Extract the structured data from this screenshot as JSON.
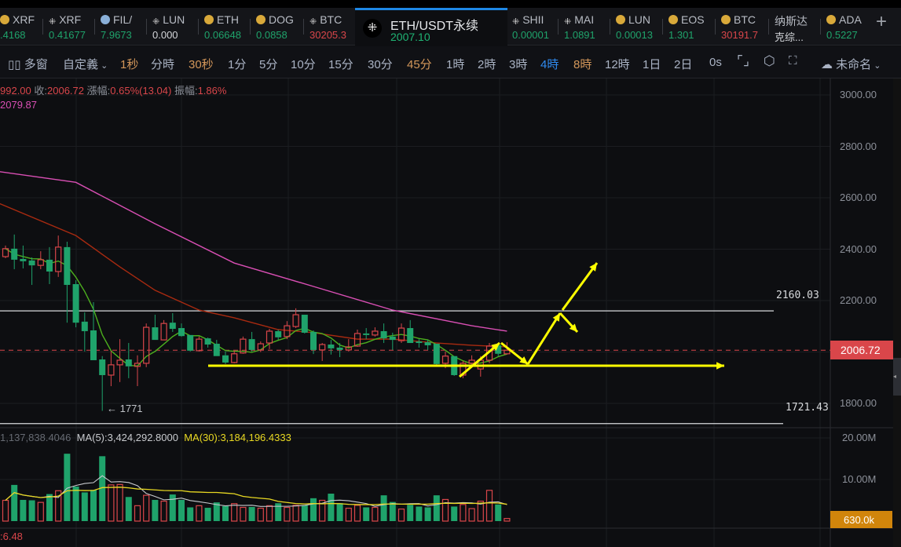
{
  "tickers": [
    {
      "name": "XRF",
      "price": ".4168",
      "color": "green",
      "icon": "coin-icon"
    },
    {
      "name": "XRF",
      "price": "0.41677",
      "color": "green",
      "icon": "okx-icon"
    },
    {
      "name": "FIL/",
      "price": "7.9673",
      "color": "green",
      "icon": "filecoin-icon"
    },
    {
      "name": "LUN",
      "price": "0.000",
      "color": "white",
      "icon": "okx-icon"
    },
    {
      "name": "ETH",
      "price": "0.06648",
      "color": "green",
      "icon": "coin-icon"
    },
    {
      "name": "DOG",
      "price": "0.0858",
      "color": "green",
      "icon": "coin-icon"
    },
    {
      "name": "BTC",
      "price": "30205.3",
      "color": "red",
      "icon": "okx-icon"
    }
  ],
  "active_ticker": {
    "name": "ETH/USDT永续",
    "price": "2007.10",
    "icon": "okx-icon"
  },
  "tickers_right": [
    {
      "name": "SHII",
      "price": "0.00001",
      "color": "green",
      "icon": "okx-icon"
    },
    {
      "name": "MAI",
      "price": "1.0891",
      "color": "green",
      "icon": "okx-icon"
    },
    {
      "name": "LUN",
      "price": "0.00013",
      "color": "green",
      "icon": "coin-icon"
    },
    {
      "name": "EOS",
      "price": "1.301",
      "color": "green",
      "icon": "coin-icon"
    },
    {
      "name": "BTC",
      "price": "30191.7",
      "color": "red",
      "icon": "coin-icon"
    },
    {
      "name": "纳斯达",
      "price": "克综...",
      "color": "white",
      "icon": ""
    },
    {
      "name": "ADA",
      "price": "0.5227",
      "color": "green",
      "icon": "coin-icon"
    }
  ],
  "toolbar": {
    "multiwindow": "多窗",
    "custom": "自定義",
    "intervals": [
      {
        "label": "1秒",
        "style": "or"
      },
      {
        "label": "分時",
        "style": ""
      },
      {
        "label": "30秒",
        "style": "or"
      },
      {
        "label": "1分",
        "style": ""
      },
      {
        "label": "5分",
        "style": ""
      },
      {
        "label": "10分",
        "style": ""
      },
      {
        "label": "15分",
        "style": ""
      },
      {
        "label": "30分",
        "style": ""
      },
      {
        "label": "45分",
        "style": "or"
      },
      {
        "label": "1時",
        "style": ""
      },
      {
        "label": "2時",
        "style": ""
      },
      {
        "label": "3時",
        "style": ""
      },
      {
        "label": "4時",
        "style": "bl"
      },
      {
        "label": "8時",
        "style": "or"
      },
      {
        "label": "12時",
        "style": ""
      },
      {
        "label": "1日",
        "style": ""
      },
      {
        "label": "2日",
        "style": ""
      },
      {
        "label": "0s",
        "style": ""
      }
    ],
    "layout_name": "未命名"
  },
  "info": {
    "open_partial": "992.00",
    "close_label": "收:",
    "close": "2006.72",
    "change_label": "漲幅:",
    "change": "0.65%(13.04)",
    "amp_label": "振幅:",
    "amp": "1.86%",
    "ma_value": "2079.87"
  },
  "volume_legend": {
    "vol": "1,137,838.4046",
    "ma5": "MA(5):3,424,292.8000",
    "ma30": "MA(30):3,184,196.4333",
    "bottom": ":6.48"
  },
  "colors": {
    "up": "#d9464a",
    "down": "#1fa36b",
    "ma_pink": "#d94fb4",
    "ma_brown": "#a82a10",
    "ma_green": "#4caf1e",
    "drawing": "#ffff00"
  },
  "chart_data": {
    "type": "candlestick",
    "price_axis": {
      "ticks": [
        "3000.00",
        "2800.00",
        "2600.00",
        "2400.00",
        "2200.00",
        "1800.00"
      ],
      "range": [
        1700,
        3000
      ],
      "current": "2006.72"
    },
    "volume_axis": {
      "ticks": [
        "20.00M",
        "10.00M"
      ],
      "current": "630.0k"
    },
    "horizontal_lines": [
      {
        "label": "2160.03",
        "value": 2160.03
      },
      {
        "label": "1721.43",
        "value": 1721.43
      }
    ],
    "low_marker": "← 1771",
    "candles": [
      [
        2371,
        2414,
        2365,
        2402
      ],
      [
        2402,
        2457,
        2322,
        2359
      ],
      [
        2362,
        2414,
        2325,
        2353
      ],
      [
        2356,
        2368,
        2261,
        2337
      ],
      [
        2337,
        2392,
        2322,
        2359
      ],
      [
        2359,
        2408,
        2264,
        2313
      ],
      [
        2313,
        2453,
        2292,
        2408
      ],
      [
        2408,
        2429,
        2114,
        2261
      ],
      [
        2264,
        2279,
        2096,
        2114
      ],
      [
        2118,
        2154,
        2002,
        2081
      ],
      [
        2084,
        2194,
        1968,
        1968
      ],
      [
        1971,
        1984,
        1771,
        1910
      ],
      [
        1910,
        2004,
        1867,
        1950
      ],
      [
        1950,
        2050,
        1883,
        1968
      ],
      [
        1971,
        2035,
        1898,
        1944
      ],
      [
        1944,
        1987,
        1867,
        1956
      ],
      [
        1956,
        2111,
        1941,
        2096
      ],
      [
        2096,
        2145,
        2047,
        2047
      ],
      [
        2047,
        2124,
        2047,
        2111
      ],
      [
        2114,
        2151,
        2078,
        2090
      ],
      [
        2093,
        2111,
        2059,
        2062
      ],
      [
        2066,
        2066,
        2002,
        2005
      ],
      [
        2005,
        2060,
        2002,
        2050
      ],
      [
        2053,
        2056,
        2017,
        2029
      ],
      [
        2032,
        2047,
        1984,
        1984
      ],
      [
        1987,
        2002,
        1953,
        1959
      ],
      [
        1959,
        2005,
        1956,
        1993
      ],
      [
        1996,
        2060,
        1993,
        2050
      ],
      [
        2050,
        2078,
        2002,
        2008
      ],
      [
        2008,
        2041,
        2000,
        2032
      ],
      [
        2035,
        2090,
        2011,
        2081
      ],
      [
        2081,
        2087,
        2047,
        2057
      ],
      [
        2060,
        2120,
        2050,
        2102
      ],
      [
        2099,
        2170,
        2093,
        2145
      ],
      [
        2145,
        2145,
        2072,
        2075
      ],
      [
        2078,
        2084,
        1992,
        2008
      ],
      [
        2008,
        2035,
        1965,
        2029
      ],
      [
        2029,
        2047,
        1990,
        2014
      ],
      [
        2017,
        2035,
        1980,
        2008
      ],
      [
        2008,
        2050,
        2002,
        2020
      ],
      [
        2023,
        2087,
        2020,
        2072
      ],
      [
        2072,
        2093,
        2050,
        2066
      ],
      [
        2066,
        2096,
        2060,
        2081
      ],
      [
        2081,
        2111,
        2035,
        2053
      ],
      [
        2060,
        2075,
        2008,
        2047
      ],
      [
        2044,
        2111,
        2035,
        2093
      ],
      [
        2093,
        2124,
        2035,
        2035
      ],
      [
        2041,
        2050,
        2017,
        2035
      ],
      [
        2038,
        2047,
        2008,
        2026
      ],
      [
        2032,
        2032,
        1950,
        1953
      ],
      [
        1956,
        2002,
        1937,
        1984
      ],
      [
        1984,
        1984,
        1907,
        1910
      ],
      [
        1910,
        1965,
        1898,
        1956
      ],
      [
        1956,
        1987,
        1944,
        1968
      ],
      [
        1934,
        1984,
        1904,
        1968
      ],
      [
        1968,
        2035,
        1956,
        2023
      ],
      [
        2026,
        2035,
        1984,
        1993
      ],
      [
        1993,
        2038,
        1990,
        2006.72
      ]
    ],
    "volumes_M": [
      5.0,
      8.7,
      5.1,
      5.0,
      4.5,
      6.5,
      7.3,
      16.2,
      8.3,
      6.9,
      7.5,
      15.6,
      8.7,
      8.8,
      5.8,
      3.7,
      6.2,
      5.1,
      4.8,
      6.4,
      5.1,
      3.3,
      3.7,
      3.2,
      4.5,
      3.6,
      4.2,
      3.3,
      3.4,
      3.1,
      3.7,
      4.3,
      3.3,
      3.8,
      3.8,
      5.5,
      5.0,
      6.6,
      4.3,
      3.1,
      3.8,
      3.3,
      3.3,
      6.2,
      4.6,
      2.9,
      3.9,
      3.5,
      3.3,
      6.2,
      5.2,
      3.5,
      4.0,
      3.0,
      4.8,
      7.4,
      4.0,
      0.63
    ],
    "ma_pink": [
      [
        -1,
        2703
      ],
      [
        8,
        2660
      ],
      [
        17,
        2499
      ],
      [
        26,
        2346
      ],
      [
        35,
        2255
      ],
      [
        44,
        2163
      ],
      [
        53,
        2102
      ],
      [
        57,
        2081
      ]
    ],
    "ma_brown": [
      [
        -1,
        2582
      ],
      [
        8,
        2453
      ],
      [
        13,
        2331
      ],
      [
        17,
        2240
      ],
      [
        22,
        2163
      ],
      [
        26,
        2133
      ],
      [
        31,
        2087
      ],
      [
        35,
        2075
      ],
      [
        40,
        2050
      ],
      [
        44,
        2050
      ],
      [
        49,
        2035
      ],
      [
        53,
        2026
      ],
      [
        57,
        2020
      ]
    ]
  }
}
